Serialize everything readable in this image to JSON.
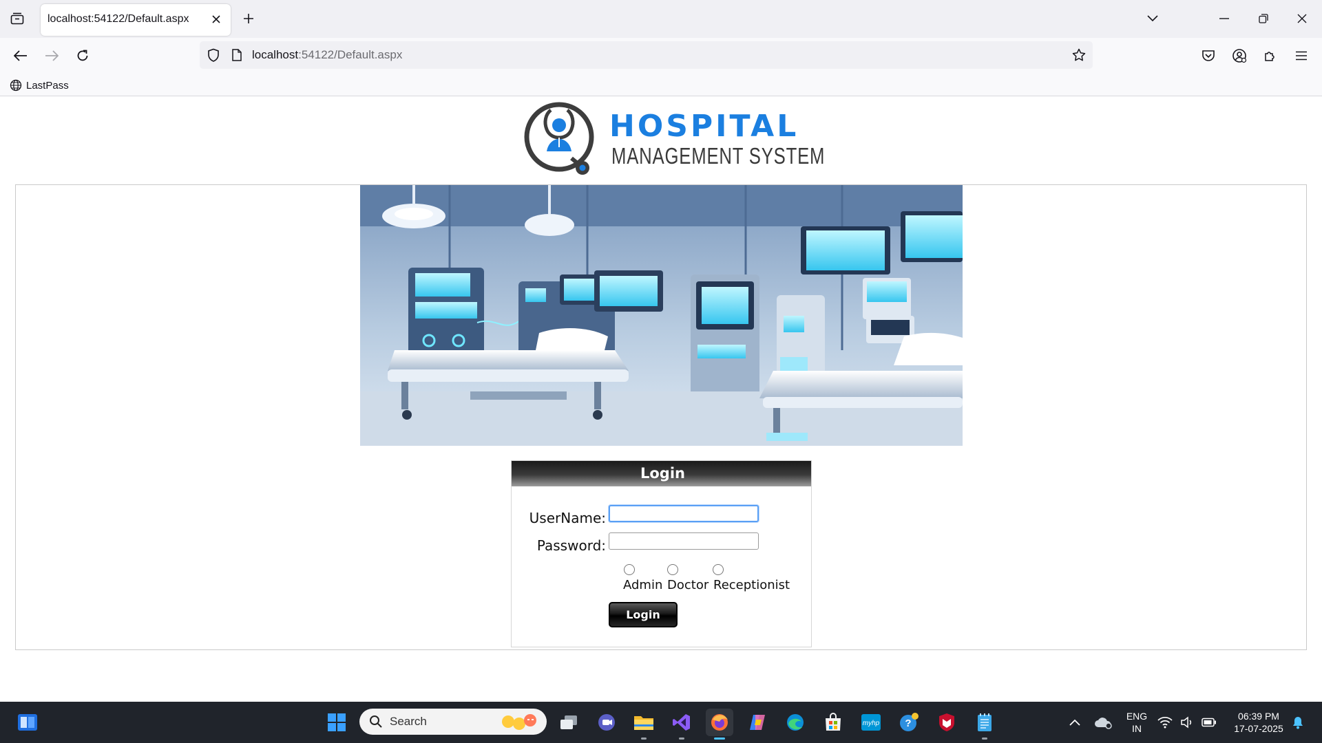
{
  "browser": {
    "tab_title": "localhost:54122/Default.aspx",
    "url_host": "localhost",
    "url_path": ":54122/Default.aspx",
    "bookmark": "LastPass"
  },
  "logo": {
    "line1": "HOSPITAL",
    "line2": "MANAGEMENT SYSTEM",
    "accent_color": "#1b7fe0"
  },
  "login": {
    "header": "Login",
    "username_label": "UserName:",
    "password_label": "Password:",
    "username_value": "",
    "password_value": "",
    "roles": [
      "Admin",
      "Doctor",
      "Receptionist"
    ],
    "button_label": "Login"
  },
  "taskbar": {
    "search_placeholder": "Search",
    "language_line1": "ENG",
    "language_line2": "IN",
    "time": "06:39 PM",
    "date": "17-07-2025"
  },
  "icons": [
    "tab-list-icon",
    "close-icon",
    "plus-icon",
    "chevron-down-icon",
    "minimize-icon",
    "restore-icon",
    "back-icon",
    "forward-icon",
    "reload-icon",
    "shield-icon",
    "page-icon",
    "star-icon",
    "pocket-icon",
    "account-icon",
    "extensions-icon",
    "menu-icon",
    "globe-icon"
  ]
}
